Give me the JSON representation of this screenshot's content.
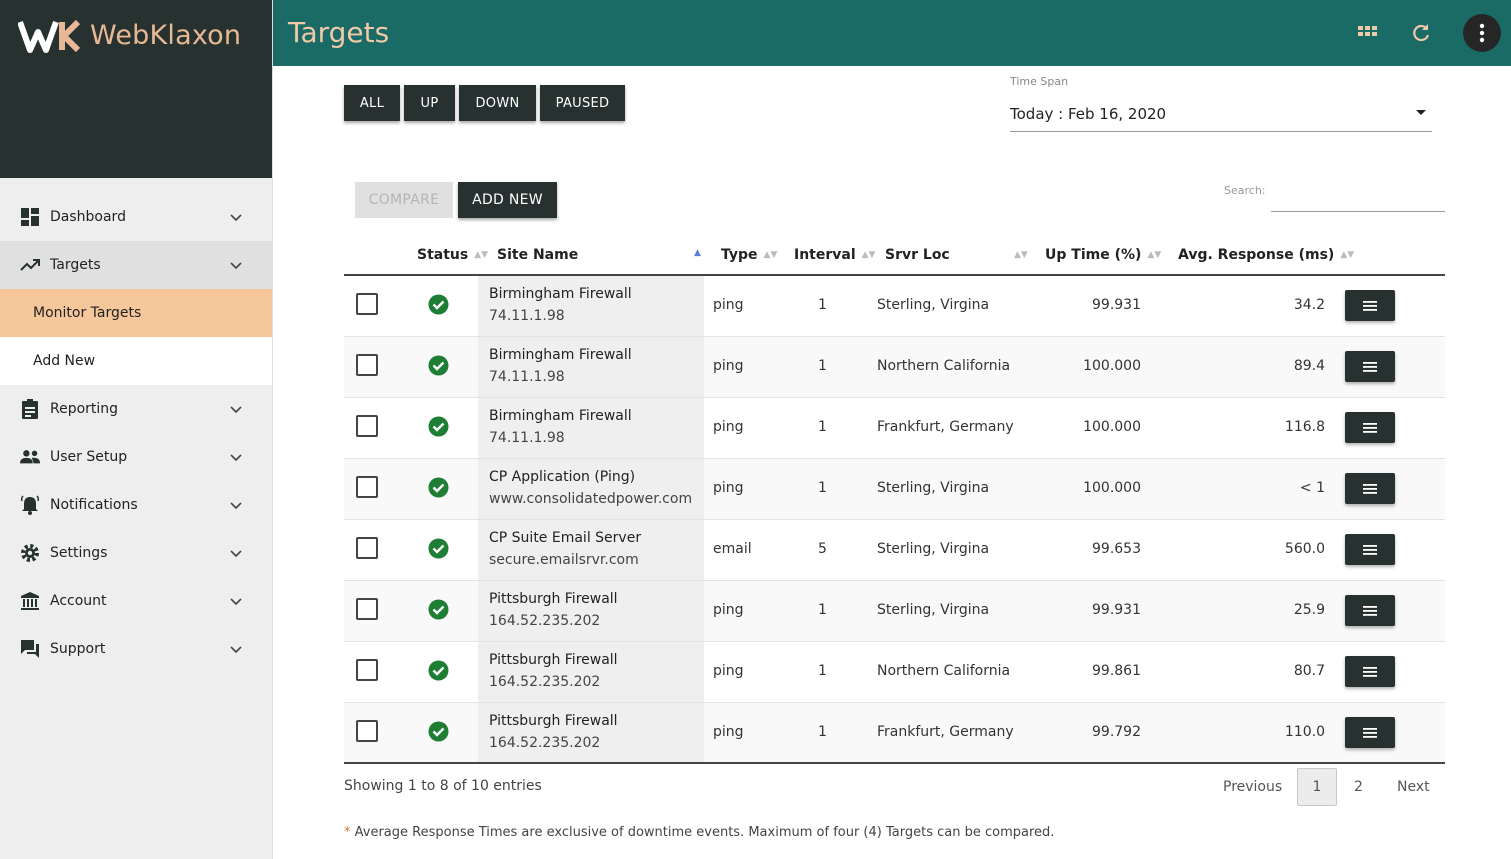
{
  "brand": {
    "name": "WebKlaxon",
    "accent": "#e7b894"
  },
  "colors": {
    "header_bg": "#1a6a66",
    "sidebar_dark": "#263130",
    "selected_item": "#f7c79c",
    "status_ok": "#1e7e34"
  },
  "sidebar": {
    "items": [
      {
        "label": "Dashboard",
        "icon": "dashboard-icon"
      },
      {
        "label": "Targets",
        "icon": "trending-up-icon"
      },
      {
        "label": "Reporting",
        "icon": "clipboard-icon"
      },
      {
        "label": "User Setup",
        "icon": "people-icon"
      },
      {
        "label": "Notifications",
        "icon": "bell-icon"
      },
      {
        "label": "Settings",
        "icon": "gear-icon"
      },
      {
        "label": "Account",
        "icon": "bank-icon"
      },
      {
        "label": "Support",
        "icon": "chat-icon"
      }
    ],
    "targets_sub": [
      {
        "label": "Monitor Targets"
      },
      {
        "label": "Add New"
      }
    ]
  },
  "header": {
    "title": "Targets",
    "icons": [
      "grid-icon",
      "refresh-icon",
      "more-vert-icon"
    ]
  },
  "filters": {
    "all": "ALL",
    "up": "UP",
    "down": "DOWN",
    "paused": "PAUSED"
  },
  "timespan": {
    "label": "Time Span",
    "value": "Today : Feb 16, 2020"
  },
  "actions": {
    "compare": "COMPARE",
    "add_new": "ADD NEW"
  },
  "search": {
    "label": "Search:",
    "value": ""
  },
  "table": {
    "headers": {
      "status": "Status",
      "site_name": "Site Name",
      "type": "Type",
      "interval": "Interval",
      "srvr_loc": "Srvr Loc",
      "uptime": "Up Time (%)",
      "avg_response": "Avg. Response (ms)"
    },
    "rows": [
      {
        "name": "Birmingham Firewall",
        "host": "74.11.1.98",
        "type": "ping",
        "interval": "1",
        "loc": "Sterling, Virgina",
        "uptime": "99.931",
        "resp": "34.2",
        "status": "up"
      },
      {
        "name": "Birmingham Firewall",
        "host": "74.11.1.98",
        "type": "ping",
        "interval": "1",
        "loc": "Northern California",
        "uptime": "100.000",
        "resp": "89.4",
        "status": "up"
      },
      {
        "name": "Birmingham Firewall",
        "host": "74.11.1.98",
        "type": "ping",
        "interval": "1",
        "loc": "Frankfurt, Germany",
        "uptime": "100.000",
        "resp": "116.8",
        "status": "up"
      },
      {
        "name": "CP Application (Ping)",
        "host": "www.consolidatedpower.com",
        "type": "ping",
        "interval": "1",
        "loc": "Sterling, Virgina",
        "uptime": "100.000",
        "resp": "< 1",
        "status": "up"
      },
      {
        "name": "CP Suite Email Server",
        "host": "secure.emailsrvr.com",
        "type": "email",
        "interval": "5",
        "loc": "Sterling, Virgina",
        "uptime": "99.653",
        "resp": "560.0",
        "status": "up"
      },
      {
        "name": "Pittsburgh Firewall",
        "host": "164.52.235.202",
        "type": "ping",
        "interval": "1",
        "loc": "Sterling, Virgina",
        "uptime": "99.931",
        "resp": "25.9",
        "status": "up"
      },
      {
        "name": "Pittsburgh Firewall",
        "host": "164.52.235.202",
        "type": "ping",
        "interval": "1",
        "loc": "Northern California",
        "uptime": "99.861",
        "resp": "80.7",
        "status": "up"
      },
      {
        "name": "Pittsburgh Firewall",
        "host": "164.52.235.202",
        "type": "ping",
        "interval": "1",
        "loc": "Frankfurt, Germany",
        "uptime": "99.792",
        "resp": "110.0",
        "status": "up"
      }
    ]
  },
  "pagination": {
    "showing": "Showing 1 to 8 of 10 entries",
    "previous": "Previous",
    "pages": [
      "1",
      "2"
    ],
    "next": "Next"
  },
  "footnote": {
    "asterisk": "*",
    "text": " Average Response Times are exclusive of downtime events. Maximum of four (4) Targets can be compared."
  }
}
